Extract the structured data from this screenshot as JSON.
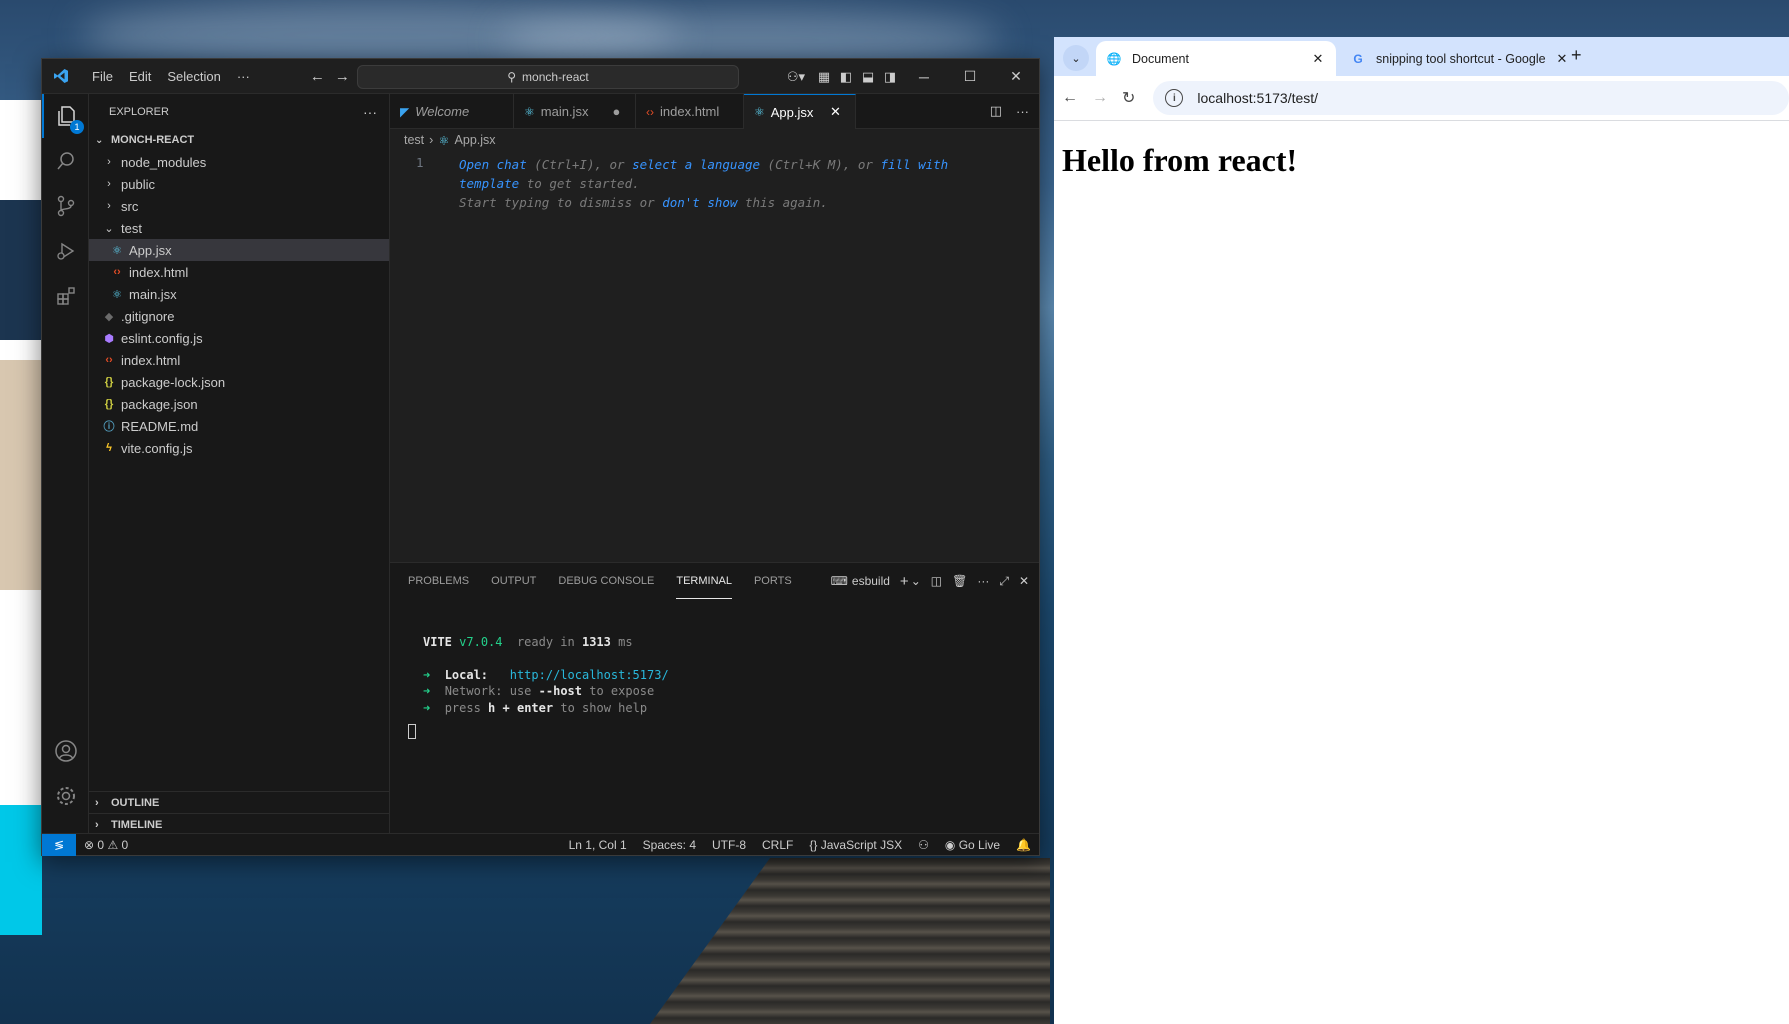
{
  "vscode": {
    "menu": [
      "File",
      "Edit",
      "Selection",
      "···"
    ],
    "search_text": "monch-react",
    "activity_badge": "1",
    "explorer_title": "EXPLORER",
    "explorer_more": "···",
    "project_name": "MONCH-REACT",
    "tree": [
      {
        "label": "node_modules",
        "type": "folder"
      },
      {
        "label": "public",
        "type": "folder"
      },
      {
        "label": "src",
        "type": "folder"
      },
      {
        "label": "test",
        "type": "folder-open"
      },
      {
        "label": "App.jsx",
        "type": "react",
        "child": true,
        "selected": true
      },
      {
        "label": "index.html",
        "type": "html",
        "child": true
      },
      {
        "label": "main.jsx",
        "type": "react",
        "child": true
      },
      {
        "label": ".gitignore",
        "type": "git"
      },
      {
        "label": "eslint.config.js",
        "type": "eslint"
      },
      {
        "label": "index.html",
        "type": "html"
      },
      {
        "label": "package-lock.json",
        "type": "json"
      },
      {
        "label": "package.json",
        "type": "json"
      },
      {
        "label": "README.md",
        "type": "info"
      },
      {
        "label": "vite.config.js",
        "type": "vite"
      }
    ],
    "outline_label": "OUTLINE",
    "timeline_label": "TIMELINE",
    "tabs": [
      {
        "label": "Welcome",
        "icon": "vscode-icon",
        "active": false,
        "dirty": false
      },
      {
        "label": "main.jsx",
        "icon": "react-icon",
        "active": false,
        "dirty": true
      },
      {
        "label": "index.html",
        "icon": "html-icon",
        "active": false,
        "dirty": false
      },
      {
        "label": "App.jsx",
        "icon": "react-icon",
        "active": true,
        "dirty": false
      }
    ],
    "breadcrumb": {
      "folder": "test",
      "file": "App.jsx"
    },
    "editor": {
      "line_number": "1",
      "hint": {
        "l1_a": "Open chat",
        "l1_b": " (Ctrl+I), or ",
        "l1_c": "select a language",
        "l1_d": " (Ctrl+K M), or ",
        "l1_e": "fill with",
        "l2_a": "template",
        "l2_b": " to get started.",
        "l3_a": "Start typing to dismiss or ",
        "l3_b": "don't show",
        "l3_c": " this again."
      }
    },
    "panel_tabs": [
      "PROBLEMS",
      "OUTPUT",
      "DEBUG CONSOLE",
      "TERMINAL",
      "PORTS"
    ],
    "terminal_name": "esbuild",
    "terminal": {
      "vite": "VITE",
      "version": "v7.0.4",
      "ready": "ready in",
      "ms_value": "1313",
      "ms": "ms",
      "local_label": "Local:",
      "local_url": "http://localhost:5173/",
      "network_label": "Network:",
      "network_a": "use",
      "network_b": "--host",
      "network_c": "to expose",
      "press": "press",
      "h": "h",
      "plus": "+",
      "enter": "enter",
      "help": "to show help"
    },
    "status": {
      "errors": "0",
      "warnings": "0",
      "position": "Ln 1, Col 1",
      "spaces": "Spaces: 4",
      "encoding": "UTF-8",
      "eol": "CRLF",
      "language": "JavaScript JSX",
      "golive": "Go Live"
    }
  },
  "chrome": {
    "tabs": [
      {
        "title": "Document",
        "active": true
      },
      {
        "title": "snipping tool shortcut - Google",
        "active": false
      }
    ],
    "url": "localhost:5173/test/",
    "page_heading": "Hello from react!"
  },
  "colors": {
    "vscode_accent": "#0078d4",
    "chrome_tabbar": "#d3e3fd",
    "link_blue": "#3794ff",
    "terminal_green": "#23d18b"
  }
}
